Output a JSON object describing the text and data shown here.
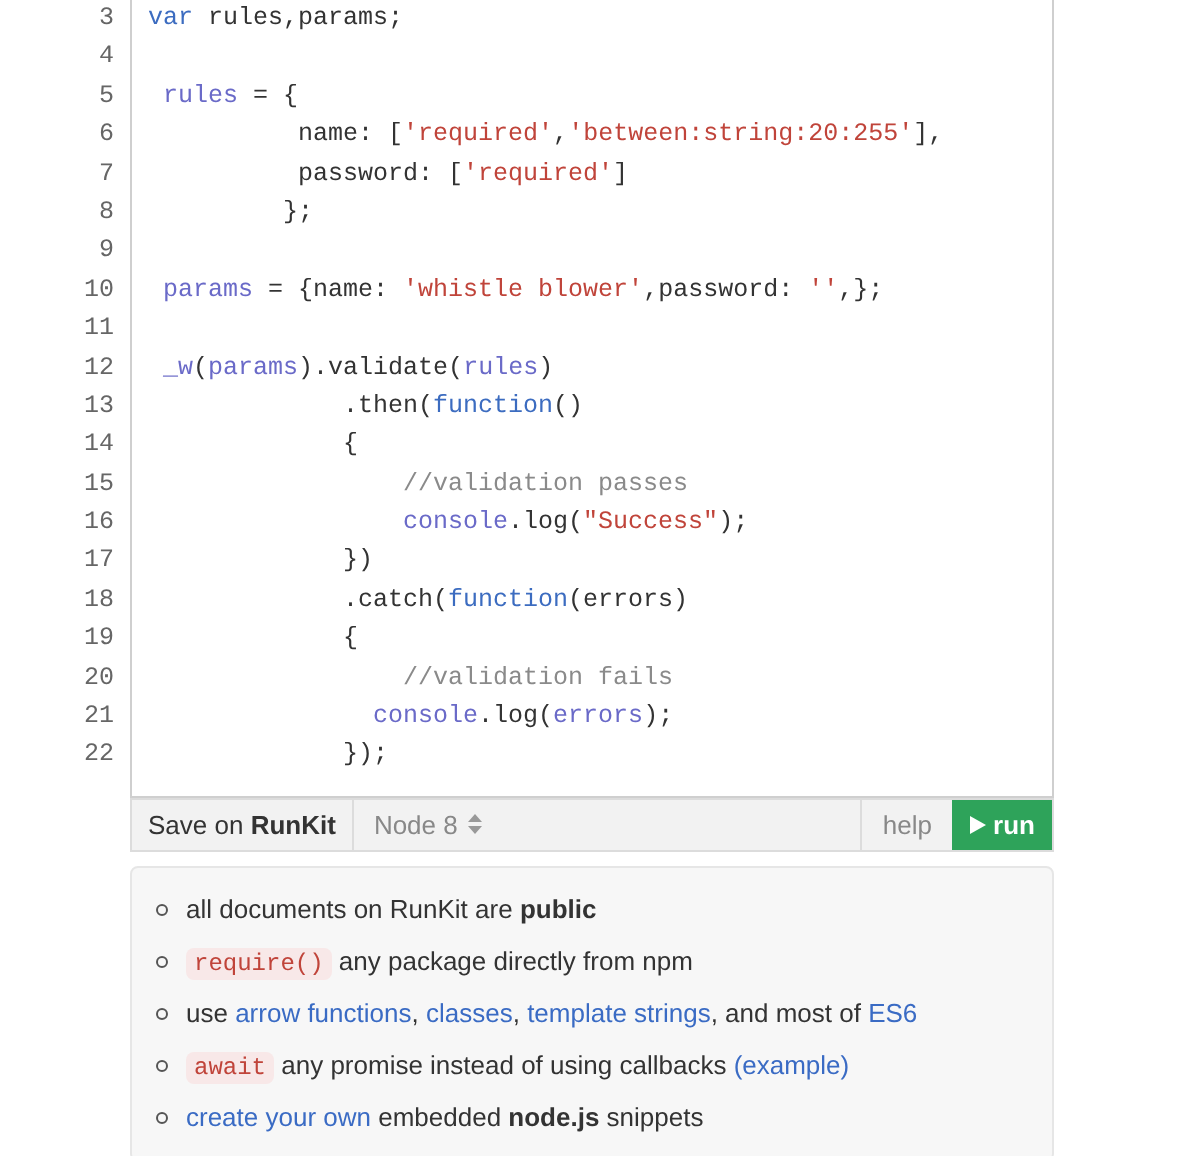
{
  "code_lines": [
    {
      "number": "3",
      "tokens": [
        {
          "kind": "keyword",
          "text": "var"
        },
        {
          "kind": "plain",
          "text": " rules,params;"
        }
      ]
    },
    {
      "number": "4"
    },
    {
      "number": "5",
      "tokens": [
        {
          "kind": "variable",
          "text": " rules"
        },
        {
          "kind": "plain",
          "text": " = {"
        }
      ]
    },
    {
      "number": "6",
      "tokens": [
        {
          "kind": "plain",
          "text": "          name: ["
        },
        {
          "kind": "string",
          "text": "'required'"
        },
        {
          "kind": "plain",
          "text": ","
        },
        {
          "kind": "string",
          "text": "'between:string:20:255'"
        },
        {
          "kind": "plain",
          "text": "],"
        }
      ]
    },
    {
      "number": "7",
      "tokens": [
        {
          "kind": "plain",
          "text": "          password: ["
        },
        {
          "kind": "string",
          "text": "'required'"
        },
        {
          "kind": "plain",
          "text": "]"
        }
      ]
    },
    {
      "number": "8",
      "tokens": [
        {
          "kind": "plain",
          "text": "         };"
        }
      ]
    },
    {
      "number": "9"
    },
    {
      "number": "10",
      "tokens": [
        {
          "kind": "variable",
          "text": " params"
        },
        {
          "kind": "plain",
          "text": " = {name: "
        },
        {
          "kind": "string",
          "text": "'whistle blower'"
        },
        {
          "kind": "plain",
          "text": ",password: "
        },
        {
          "kind": "string",
          "text": "''"
        },
        {
          "kind": "plain",
          "text": ",};"
        }
      ]
    },
    {
      "number": "11"
    },
    {
      "number": "12",
      "tokens": [
        {
          "kind": "variable",
          "text": " _w"
        },
        {
          "kind": "plain",
          "text": "("
        },
        {
          "kind": "variable",
          "text": "params"
        },
        {
          "kind": "plain",
          "text": ").validate("
        },
        {
          "kind": "variable",
          "text": "rules"
        },
        {
          "kind": "plain",
          "text": ")"
        }
      ]
    },
    {
      "number": "13",
      "tokens": [
        {
          "kind": "plain",
          "text": "             .then("
        },
        {
          "kind": "keyword",
          "text": "function"
        },
        {
          "kind": "plain",
          "text": "()"
        }
      ]
    },
    {
      "number": "14",
      "tokens": [
        {
          "kind": "plain",
          "text": "             {"
        }
      ]
    },
    {
      "number": "15",
      "tokens": [
        {
          "kind": "comment",
          "text": "                 //validation passes"
        }
      ]
    },
    {
      "number": "16",
      "tokens": [
        {
          "kind": "variable",
          "text": "                 console"
        },
        {
          "kind": "plain",
          "text": ".log("
        },
        {
          "kind": "string",
          "text": "\"Success\""
        },
        {
          "kind": "plain",
          "text": ");"
        }
      ]
    },
    {
      "number": "17",
      "tokens": [
        {
          "kind": "plain",
          "text": "             })"
        }
      ]
    },
    {
      "number": "18",
      "tokens": [
        {
          "kind": "plain",
          "text": "             .catch("
        },
        {
          "kind": "keyword",
          "text": "function"
        },
        {
          "kind": "plain",
          "text": "(errors)"
        }
      ]
    },
    {
      "number": "19",
      "tokens": [
        {
          "kind": "plain",
          "text": "             {"
        }
      ]
    },
    {
      "number": "20",
      "tokens": [
        {
          "kind": "comment",
          "text": "                 //validation fails"
        }
      ]
    },
    {
      "number": "21",
      "tokens": [
        {
          "kind": "variable",
          "text": "               console"
        },
        {
          "kind": "plain",
          "text": ".log("
        },
        {
          "kind": "variable",
          "text": "errors"
        },
        {
          "kind": "plain",
          "text": ");"
        }
      ]
    },
    {
      "number": "22",
      "tokens": [
        {
          "kind": "plain",
          "text": "             });"
        }
      ]
    }
  ],
  "toolbar": {
    "save": "Save on **RunKit**",
    "node_version": "Node 8",
    "help": "help",
    "run": "run"
  },
  "notes": [
    {
      "segments": [
        {
          "kind": "text",
          "text": "all documents on RunKit are "
        },
        {
          "kind": "bold",
          "text": "public"
        }
      ]
    },
    {
      "segments": [
        {
          "kind": "code",
          "text": "require()"
        },
        {
          "kind": "text",
          "text": " any package directly from npm"
        }
      ]
    },
    {
      "segments": [
        {
          "kind": "text",
          "text": "use "
        },
        {
          "kind": "link",
          "text": "arrow functions"
        },
        {
          "kind": "text",
          "text": ", "
        },
        {
          "kind": "link",
          "text": "classes"
        },
        {
          "kind": "text",
          "text": ", "
        },
        {
          "kind": "link",
          "text": "template strings"
        },
        {
          "kind": "text",
          "text": ", and most of "
        },
        {
          "kind": "link",
          "text": "ES6"
        }
      ]
    },
    {
      "segments": [
        {
          "kind": "code",
          "text": "await"
        },
        {
          "kind": "text",
          "text": " any promise instead of using callbacks "
        },
        {
          "kind": "link",
          "text": "(example)"
        }
      ]
    },
    {
      "segments": [
        {
          "kind": "link",
          "text": "create your own"
        },
        {
          "kind": "text",
          "text": " embedded "
        },
        {
          "kind": "bold",
          "text": "node.js"
        },
        {
          "kind": "text",
          "text": " snippets"
        }
      ]
    }
  ]
}
